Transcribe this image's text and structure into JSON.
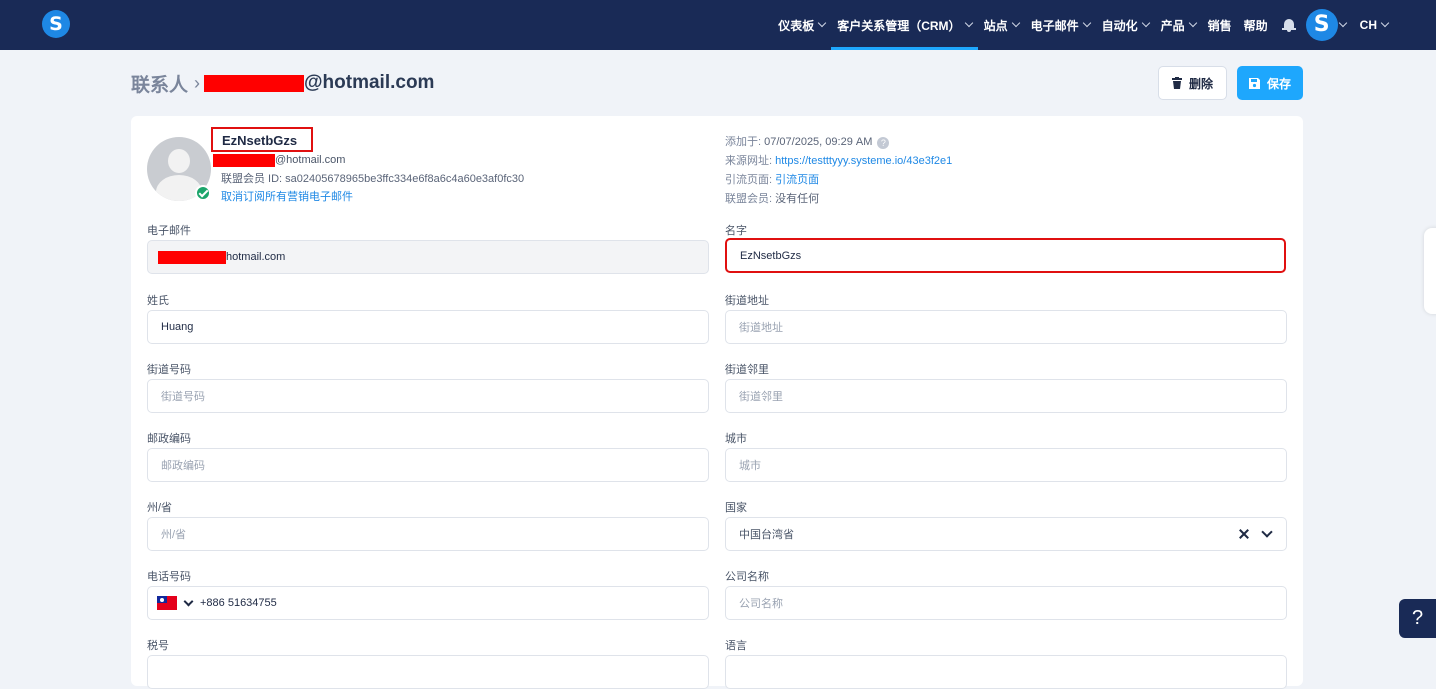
{
  "nav": {
    "items": [
      {
        "label": "仪表板",
        "chevron": true,
        "active": false
      },
      {
        "label": "客户关系管理（CRM）",
        "chevron": true,
        "active": true
      },
      {
        "label": "站点",
        "chevron": true,
        "active": false
      },
      {
        "label": "电子邮件",
        "chevron": true,
        "active": false
      },
      {
        "label": "自动化",
        "chevron": true,
        "active": false
      },
      {
        "label": "产品",
        "chevron": true,
        "active": false
      },
      {
        "label": "销售",
        "chevron": false,
        "active": false
      },
      {
        "label": "帮助",
        "chevron": false,
        "active": false
      }
    ],
    "logo_letter": "S",
    "avatar_letter": "S",
    "lang": "CH"
  },
  "header": {
    "breadcrumb_root": "联系人",
    "breadcrumb_sep": "›",
    "breadcrumb_email": "@hotmail.com",
    "delete_label": "删除",
    "save_label": "保存"
  },
  "profile": {
    "name": "EzNsetbGzs",
    "email_suffix": "@hotmail.com",
    "affiliate_id": "联盟会员 ID: sa02405678965be3ffc334e6f8a6c4a60e3af0fc30",
    "unsubscribe": "取消订阅所有营销电子邮件"
  },
  "meta": {
    "added_label": "添加于:",
    "added_value": "07/07/2025, 09:29 AM",
    "source_label": "来源网址:",
    "source_value": "https://testttyyy.systeme.io/43e3f2e1",
    "ref_label": "引流页面:",
    "ref_value": "引流页面",
    "aff_label": "联盟会员:",
    "aff_value": "没有任何"
  },
  "form": {
    "email": {
      "label": "电子邮件",
      "value": "hotmail.com"
    },
    "first_name": {
      "label": "名字",
      "value": "EzNsetbGzs"
    },
    "last_name": {
      "label": "姓氏",
      "value": "Huang"
    },
    "street_address": {
      "label": "街道地址",
      "placeholder": "街道地址"
    },
    "street_number": {
      "label": "街道号码",
      "placeholder": "街道号码"
    },
    "street_neighborhood": {
      "label": "街道邻里",
      "placeholder": "街道邻里"
    },
    "postcode": {
      "label": "邮政编码",
      "placeholder": "邮政编码"
    },
    "city": {
      "label": "城市",
      "placeholder": "城市"
    },
    "state": {
      "label": "州/省",
      "placeholder": "州/省"
    },
    "country": {
      "label": "国家",
      "value": "中国台湾省"
    },
    "phone": {
      "label": "电话号码",
      "value": "+886 51634755"
    },
    "company": {
      "label": "公司名称",
      "placeholder": "公司名称"
    },
    "tax": {
      "label": "税号"
    },
    "language": {
      "label": "语言"
    }
  },
  "help_label": "?",
  "colors": {
    "nav_bg": "#192a56",
    "accent": "#1ea7fd",
    "highlight": "#e01010",
    "redaction": "#ff0000"
  }
}
